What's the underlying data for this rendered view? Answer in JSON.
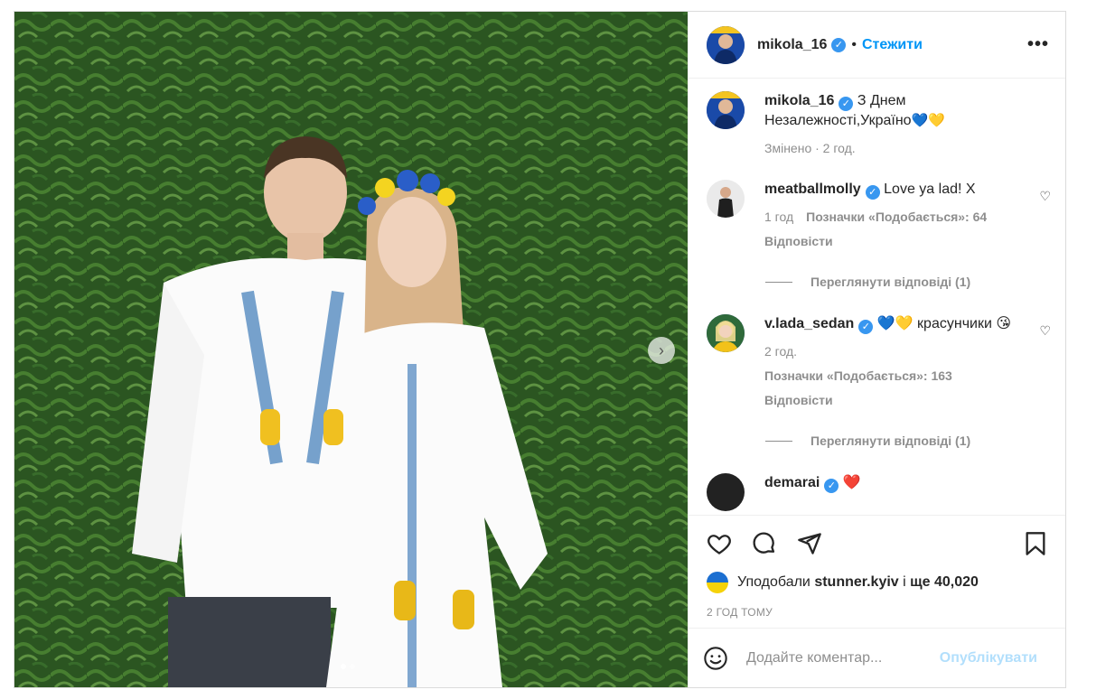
{
  "post": {
    "username": "mikola_16",
    "follow_label": "Стежити",
    "more_label": "•••",
    "next_label": "›",
    "caption": {
      "username": "mikola_16",
      "text": "З Днем Незалежності,Україно",
      "emoji": "💙💛",
      "meta": "Змінено · 2 год."
    },
    "comments": [
      {
        "username": "meatballmolly",
        "text": "Love ya lad! X",
        "time": "1 год",
        "likes": "Позначки «Подобається»: 64",
        "reply": "Відповісти",
        "view_replies": "Переглянути відповіді (1)"
      },
      {
        "username": "v.lada_sedan",
        "text": "💙💛 красунчики 😘",
        "time": "2 год.",
        "likes": "Позначки «Подобається»: 163",
        "reply": "Відповісти",
        "view_replies": "Переглянути відповіді (1)"
      },
      {
        "username": "demarai",
        "text": "❤️"
      }
    ],
    "liked_prefix": "Уподобали",
    "liked_user": "stunner.kyiv",
    "liked_suffix": "і",
    "liked_count": "ще 40,020",
    "time_ago": "2 ГОД ТОМУ",
    "comment_placeholder": "Додайте коментар...",
    "publish_label": "Опублікувати",
    "carousel": {
      "slides": 2,
      "active": 1
    }
  },
  "colors": {
    "accent": "#0095f6",
    "publish_disabled": "#b2dffc",
    "verified": "#3897f0"
  }
}
